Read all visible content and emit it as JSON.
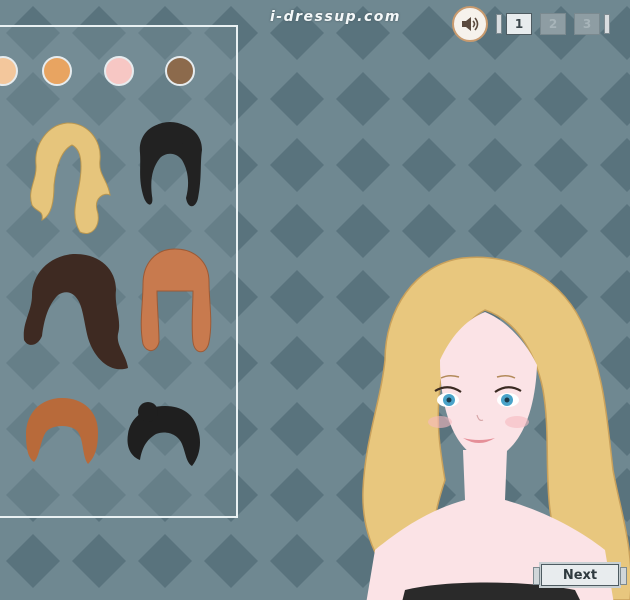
{
  "site": {
    "logo_text": "i-dressup.com"
  },
  "controls": {
    "sound_icon": "speaker-icon",
    "pages": [
      {
        "label": "1",
        "active": true
      },
      {
        "label": "2",
        "active": false
      },
      {
        "label": "3",
        "active": false
      }
    ],
    "next_label": "Next"
  },
  "skin_tones": [
    {
      "color": "#f3c79c"
    },
    {
      "color": "#e8a461"
    },
    {
      "color": "#f7c7c4"
    },
    {
      "color": "#8c6a4c"
    }
  ],
  "hairstyles": [
    {
      "style": "long-wavy",
      "color": "#e6c57c"
    },
    {
      "style": "updo",
      "color": "#222222"
    },
    {
      "style": "long-layered",
      "color": "#3e2a22"
    },
    {
      "style": "long-bangs",
      "color": "#c87a4e"
    },
    {
      "style": "bob",
      "color": "#b86a3a"
    },
    {
      "style": "side-bun",
      "color": "#1f1f1f"
    }
  ],
  "colors": {
    "background": "#6f8891",
    "diamond": "#59737d",
    "panel_border": "#e9f1f3",
    "model_hair": "#e8c77e",
    "model_skin": "#fbe3e6"
  }
}
